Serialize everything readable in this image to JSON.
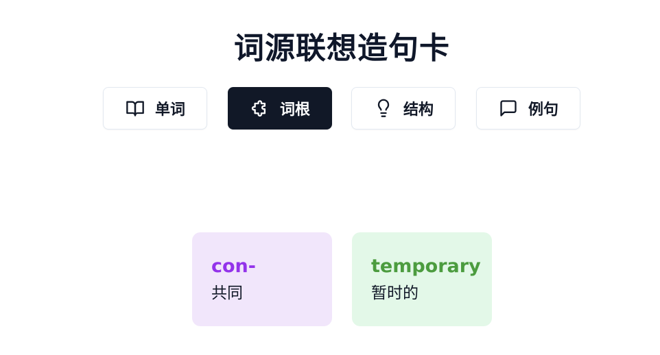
{
  "title": "词源联想造句卡",
  "tabs": [
    {
      "label": "单词",
      "icon": "book-open-icon",
      "active": false
    },
    {
      "label": "词根",
      "icon": "puzzle-icon",
      "active": true
    },
    {
      "label": "结构",
      "icon": "lightbulb-icon",
      "active": false
    },
    {
      "label": "例句",
      "icon": "message-square-icon",
      "active": false
    }
  ],
  "cards": [
    {
      "word": "con-",
      "meaning": "共同",
      "bg": "#f1e6fb",
      "color": "#9333ea"
    },
    {
      "word": "temporary",
      "meaning": "暂时的",
      "bg": "#e3f8e8",
      "color": "#4c9c3f"
    }
  ]
}
